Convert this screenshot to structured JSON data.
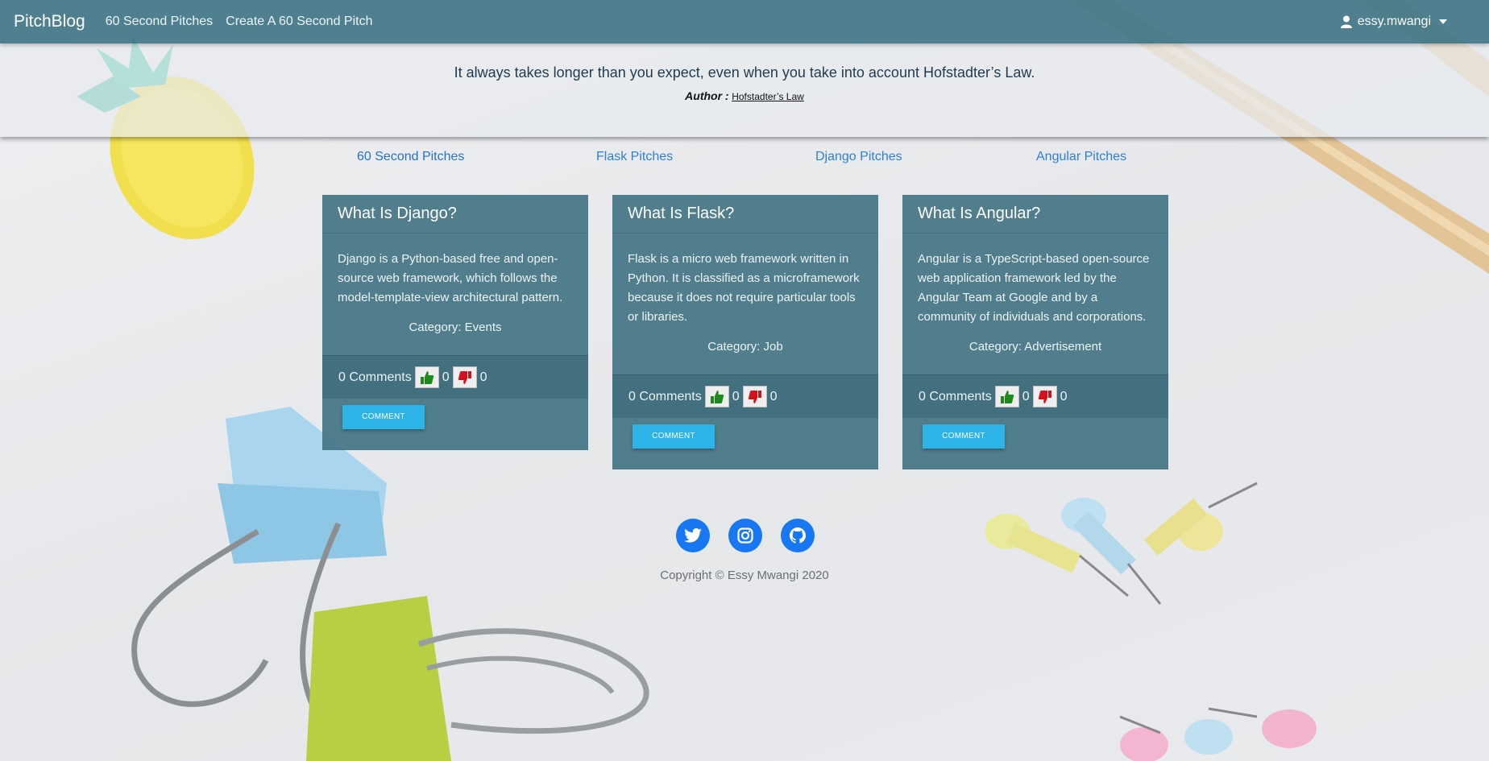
{
  "navbar": {
    "brand": "PitchBlog",
    "links": [
      "60 Second Pitches",
      "Create A 60 Second Pitch"
    ],
    "user": "essy.mwangi"
  },
  "quote": {
    "text": "It always takes longer than you expect, even when you take into account Hofstadter’s Law.",
    "author_label": "Author :",
    "author": "Hofstadter’s Law"
  },
  "tabs": [
    "60 Second Pitches",
    "Flask Pitches",
    "Django Pitches",
    "Angular Pitches"
  ],
  "cards": [
    {
      "title": "What Is Django?",
      "body": "Django is a Python-based free and open-source web framework, which follows the model-template-view architectural pattern.",
      "category": "Category: Events",
      "comments": "0 Comments",
      "upvotes": "0",
      "downvotes": "0",
      "button": "COMMENT"
    },
    {
      "title": "What Is Flask?",
      "body": "Flask is a micro web framework written in Python. It is classified as a microframework because it does not require particular tools or libraries.",
      "category": "Category: Job",
      "comments": "0 Comments",
      "upvotes": "0",
      "downvotes": "0",
      "button": "COMMENT"
    },
    {
      "title": "What Is Angular?",
      "body": "Angular is a TypeScript-based open-source web application framework led by the Angular Team at Google and by a community of individuals and corporations.",
      "category": "Category: Advertisement",
      "comments": "0 Comments",
      "upvotes": "0",
      "downvotes": "0",
      "button": "COMMENT"
    }
  ],
  "footer": {
    "social_icons": [
      "twitter-icon",
      "instagram-icon",
      "github-icon"
    ],
    "copyright": "Copyright © Essy Mwangi 2020"
  },
  "colors": {
    "navbar": "#407688",
    "card": "#457585",
    "accent_link": "#2b7fd8",
    "comment_button": "#2cb3e8",
    "social": "#1877f2",
    "upvote": "#1a8a1a",
    "downvote": "#d0131b"
  }
}
